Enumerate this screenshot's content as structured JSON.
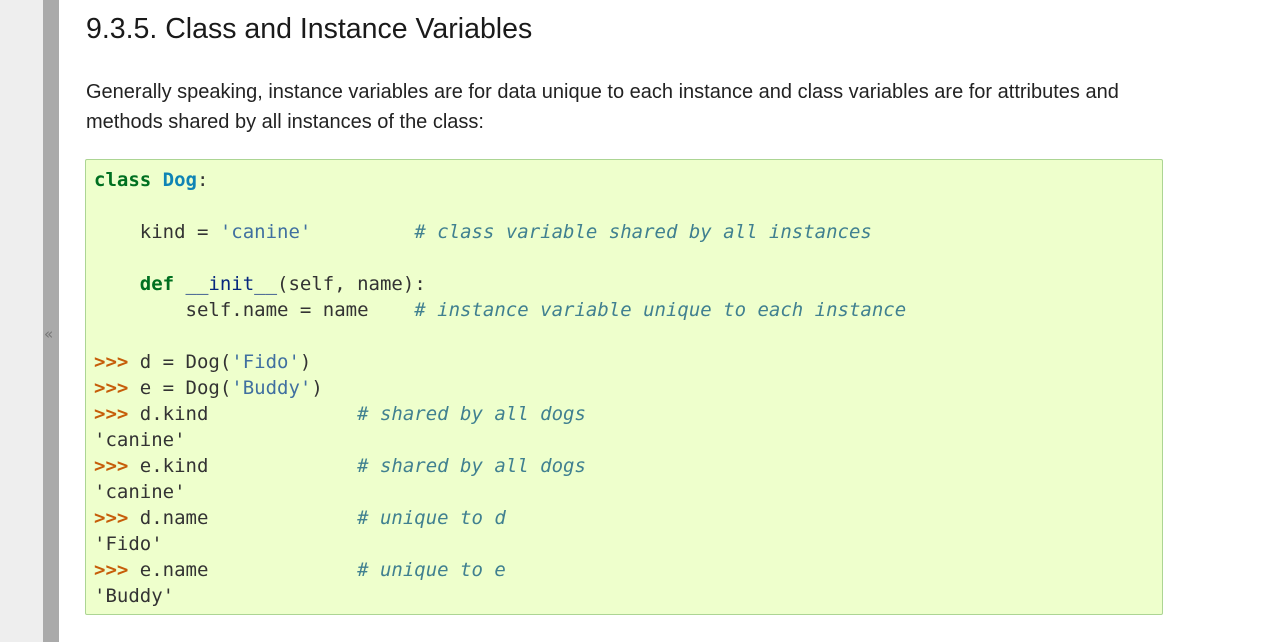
{
  "sidebar": {
    "collapse_glyph": "«"
  },
  "page": {
    "title": "9.3.5. Class and Instance Variables",
    "intro": "Generally speaking, instance variables are for data unique to each instance and class variables are for attributes and methods shared by all instances of the class:"
  },
  "code": {
    "l1": {
      "kw": "class",
      "name": "Dog",
      "punct": ":"
    },
    "l2": {
      "pre": "    kind = ",
      "str": "'canine'",
      "pad": "         ",
      "comment": "# class variable shared by all instances"
    },
    "l3": {
      "indent": "    ",
      "kw": "def",
      "fn": " __init__",
      "rest": "(self, name):"
    },
    "l4": {
      "pre": "        self.name = name    ",
      "comment": "# instance variable unique to each instance"
    },
    "l5": {
      "prompt": ">>>",
      "code": " d = Dog(",
      "str": "'Fido'",
      "close": ")"
    },
    "l6": {
      "prompt": ">>>",
      "code": " e = Dog(",
      "str": "'Buddy'",
      "close": ")"
    },
    "l7": {
      "prompt": ">>>",
      "code": " d.kind             ",
      "comment": "# shared by all dogs"
    },
    "l8": {
      "out": "'canine'"
    },
    "l9": {
      "prompt": ">>>",
      "code": " e.kind             ",
      "comment": "# shared by all dogs"
    },
    "l10": {
      "out": "'canine'"
    },
    "l11": {
      "prompt": ">>>",
      "code": " d.name             ",
      "comment": "# unique to d"
    },
    "l12": {
      "out": "'Fido'"
    },
    "l13": {
      "prompt": ">>>",
      "code": " e.name             ",
      "comment": "# unique to e"
    },
    "l14": {
      "out": "'Buddy'"
    }
  }
}
